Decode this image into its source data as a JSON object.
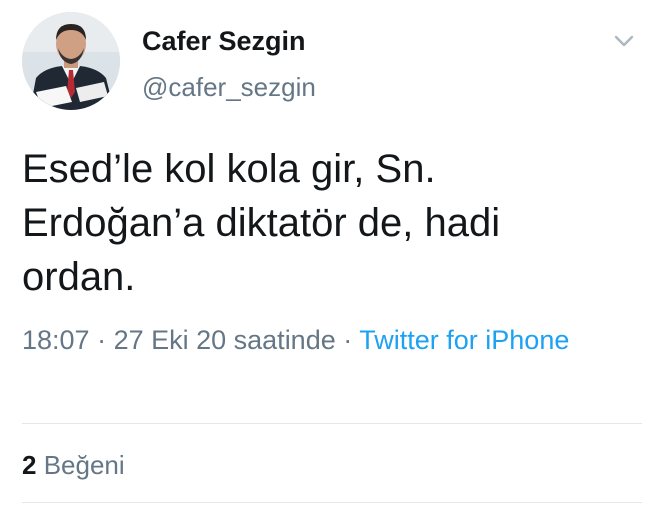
{
  "user": {
    "name": "Cafer Sezgin",
    "handle": "@cafer_sezgin"
  },
  "tweet": {
    "text": "Esed’le kol kola gir, Sn. Erdoğan’a diktatör de, hadi ordan.",
    "time": "18:07",
    "date": "27 Eki 20 saatinde",
    "separator": " · ",
    "source": "Twitter for iPhone"
  },
  "stats": {
    "likes_count": "2",
    "likes_label": "Beğeni"
  },
  "icons": {
    "menu": "chevron-down-icon"
  },
  "colors": {
    "text": "#14171a",
    "secondary": "#657786",
    "link": "#1da1f2",
    "divider": "#e1e8ed"
  }
}
